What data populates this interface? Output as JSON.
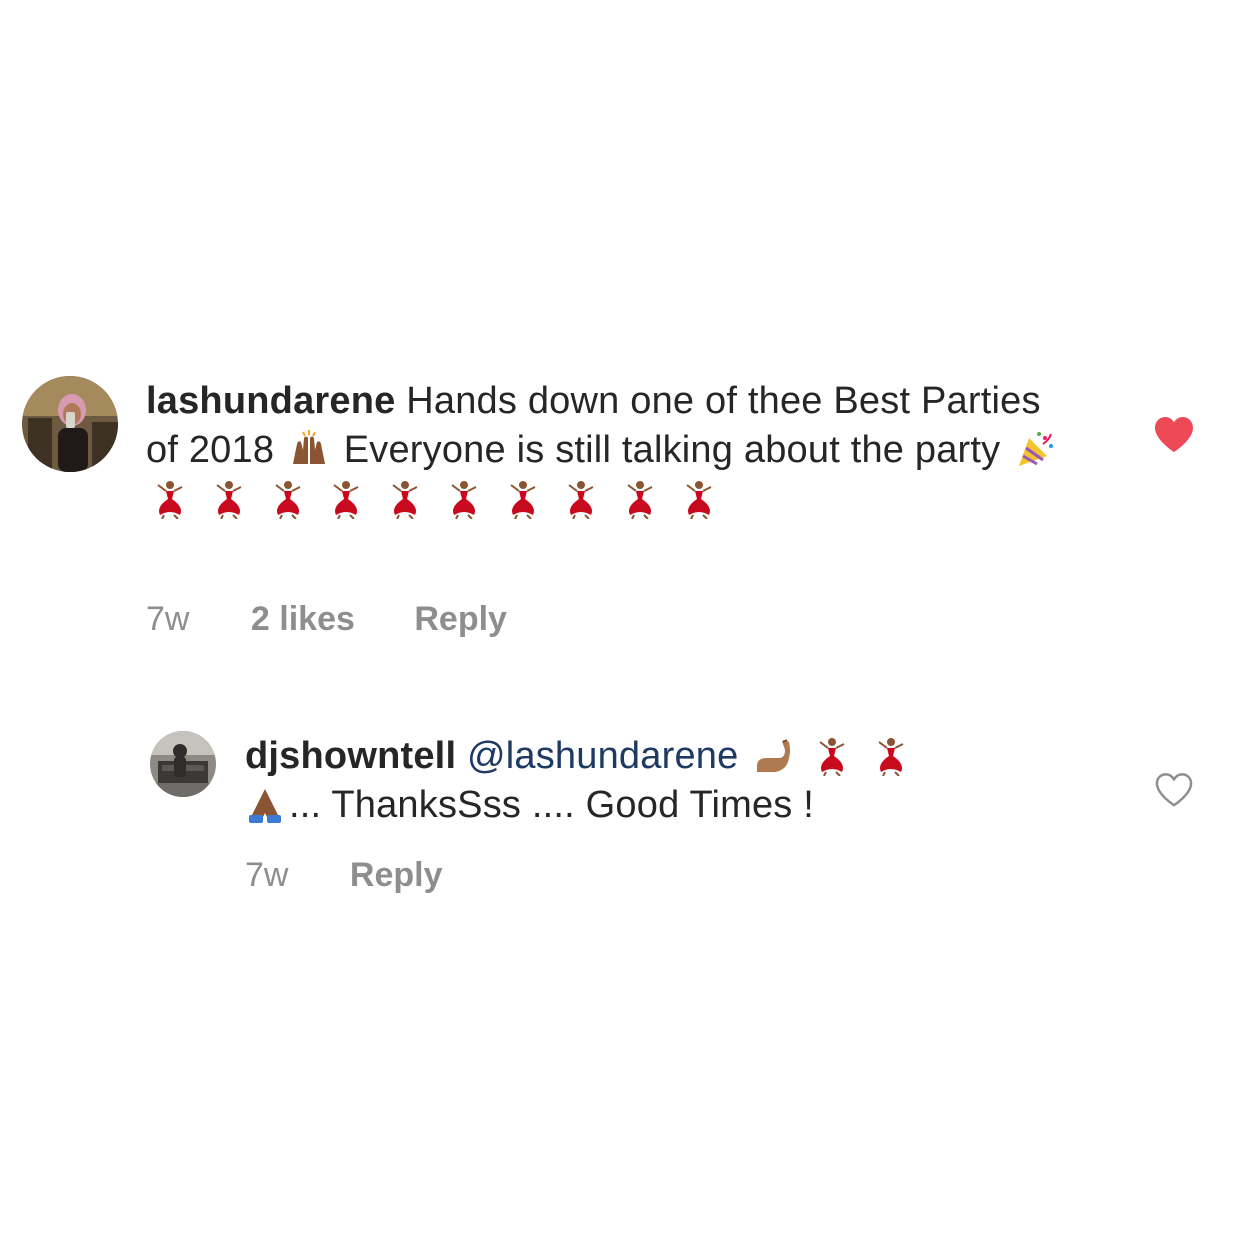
{
  "comments": [
    {
      "username": "lashundarene",
      "text_part1": "Hands down one of thee Best Parties of 2018",
      "text_part2": "Everyone is still talking about the party",
      "emoji": {
        "after_part1": "raising-hands-emoji",
        "after_part2": [
          "party-popper-emoji",
          "dancer-emoji",
          "dancer-emoji",
          "dancer-emoji",
          "dancer-emoji",
          "dancer-emoji",
          "dancer-emoji",
          "dancer-emoji",
          "dancer-emoji",
          "dancer-emoji",
          "dancer-emoji"
        ]
      },
      "time": "7w",
      "likes": "2 likes",
      "reply": "Reply",
      "liked": true,
      "like_icon": "heart-filled-icon",
      "like_color": "#ed4956"
    },
    {
      "username": "djshowntell",
      "mention": "@lashundarene",
      "text": "... ThanksSss .... Good Times !",
      "emoji": {
        "after_mention": [
          "flexed-biceps-emoji",
          "dancer-emoji",
          "dancer-emoji"
        ],
        "before_text": "folded-hands-emoji"
      },
      "time": "7w",
      "reply": "Reply",
      "liked": false,
      "like_icon": "heart-outline-icon",
      "like_color": "#8e8e8e"
    }
  ]
}
